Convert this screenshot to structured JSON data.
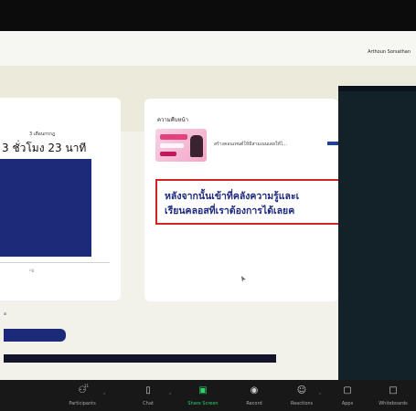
{
  "meeting": {
    "participant_name": "Arthoun Sorsathan"
  },
  "left_panel": {
    "stat_small": "3 เดือนกรกฎ",
    "stat_big": "3 ชั่วโมง 23 นาที",
    "axis_tick": "ภฏ"
  },
  "middle_panel": {
    "header": "ความคืบหน้า",
    "thumbnail_subtext": "สร้างคอนเทนต์ให้มีสามเนนเดยให้ไ…",
    "redbox_line1": "หลังจากนั้นเข้าที่คลังความรู้และเ",
    "redbox_line2": "เรียนคลอสที่เราต้องการได้เลยค"
  },
  "bottom_left_label": "อ",
  "toolbar": {
    "participants": {
      "label": "Participants",
      "count": "11"
    },
    "chat": {
      "label": "Chat"
    },
    "share_screen": {
      "label": "Share Screen"
    },
    "record": {
      "label": "Record"
    },
    "reactions": {
      "label": "Reactions"
    },
    "apps": {
      "label": "Apps"
    },
    "whiteboards": {
      "label": "Whiteboards"
    }
  },
  "colors": {
    "bar": "#1c2a7a",
    "share_green": "#2fd06b",
    "redbox_border": "#d02424",
    "redbox_text": "#1e2a7e"
  }
}
